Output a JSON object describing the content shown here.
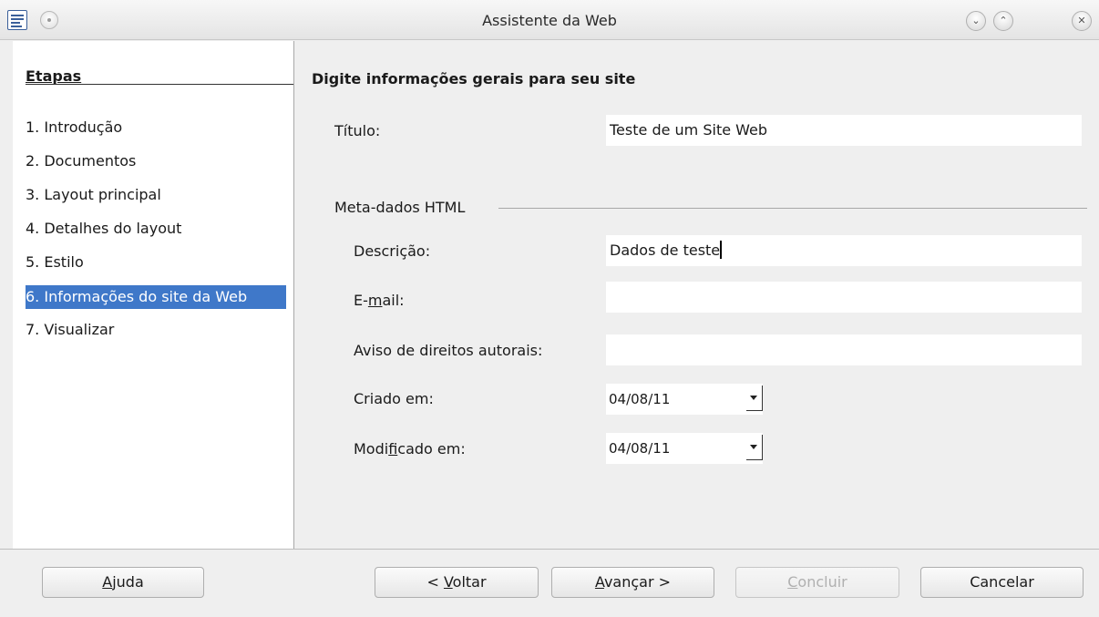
{
  "window": {
    "title": "Assistente da Web"
  },
  "steps": {
    "title": "Etapas",
    "items": [
      {
        "label": "1. Introdução",
        "active": false
      },
      {
        "label": "2. Documentos",
        "active": false
      },
      {
        "label": "3. Layout principal",
        "active": false
      },
      {
        "label": "4. Detalhes do layout",
        "active": false
      },
      {
        "label": "5. Estilo",
        "active": false
      },
      {
        "label": "6. Informações do site da Web",
        "active": true
      },
      {
        "label": "7. Visualizar",
        "active": false
      }
    ]
  },
  "main": {
    "heading": "Digite informações gerais para seu site",
    "title_label": "Título:",
    "title_value": "Teste de um Site Web",
    "meta_group": "Meta-dados HTML",
    "description_label": "Descrição:",
    "description_value": "Dados de teste",
    "email_label_pre": "E-",
    "email_label_mn": "m",
    "email_label_post": "ail:",
    "email_value": "",
    "copyright_label": "Aviso de direitos autorais:",
    "copyright_value": "",
    "created_label": "Criado em:",
    "created_value": "04/08/11",
    "modified_label_pre": "Modi",
    "modified_label_mn": "f",
    "modified_label_post": "icado em:",
    "modified_value": "04/08/11"
  },
  "buttons": {
    "help_mn": "A",
    "help_rest": "juda",
    "back_pre": "< ",
    "back_mn": "V",
    "back_rest": "oltar",
    "next_mn": "A",
    "next_rest": "vançar >",
    "finish_mn": "C",
    "finish_rest": "oncluir",
    "cancel": "Cancelar"
  },
  "icons": {
    "app": "writer-document-icon",
    "window_menu": "window-menu-icon",
    "minimize": "minimize-icon",
    "maximize": "maximize-icon",
    "close": "close-icon"
  },
  "colors": {
    "selection": "#3f78c9",
    "panel": "#ffffff",
    "background": "#efefef"
  }
}
